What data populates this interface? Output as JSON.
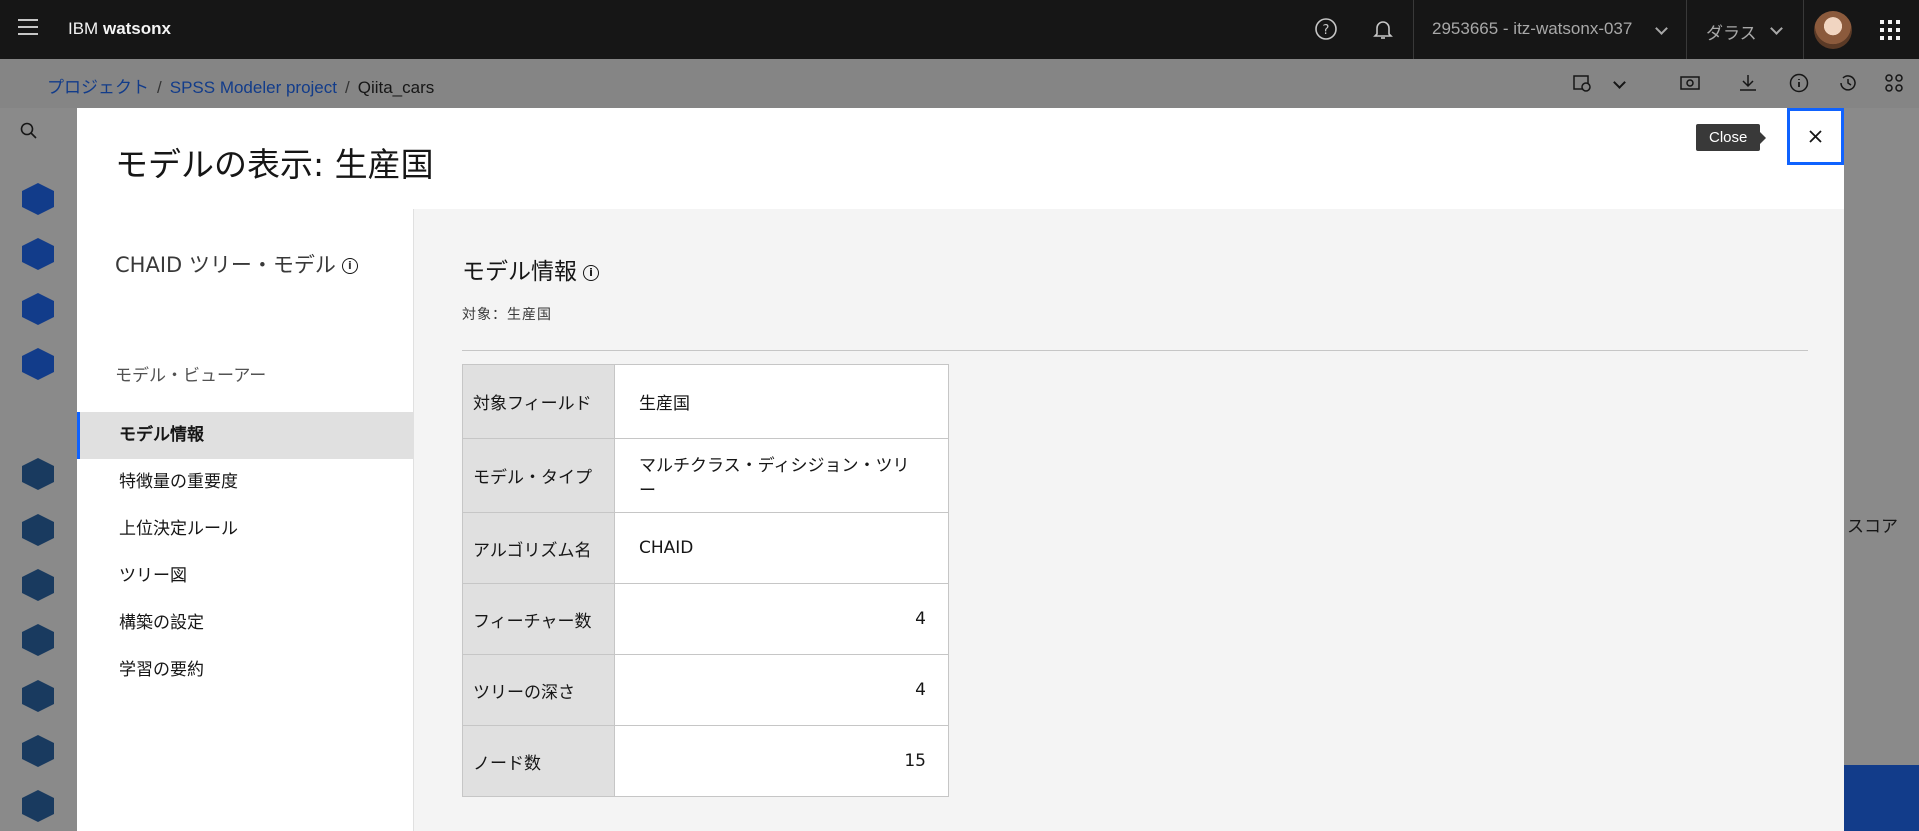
{
  "header": {
    "brand_prefix": "IBM",
    "brand_name": "watsonx",
    "account": "2953665 - itz-watsonx-037",
    "region": "ダラス"
  },
  "breadcrumb": {
    "items": [
      "プロジェクト",
      "SPSS Modeler project"
    ],
    "current": "Qiita_cars"
  },
  "background": {
    "right_text": "スコア"
  },
  "modal": {
    "title": "モデルの表示: 生産国",
    "close_tooltip": "Close",
    "model_name": "CHAID ツリー・モデル",
    "viewer_label": "モデル・ビューアー",
    "nav": [
      {
        "label": "モデル情報",
        "active": true
      },
      {
        "label": "特徴量の重要度",
        "active": false
      },
      {
        "label": "上位決定ルール",
        "active": false
      },
      {
        "label": "ツリー図",
        "active": false
      },
      {
        "label": "構築の設定",
        "active": false
      },
      {
        "label": "学習の要約",
        "active": false
      }
    ],
    "section_title": "モデル情報",
    "target_label": "対象：生産国",
    "table": [
      {
        "key": "対象フィールド",
        "value": "生産国",
        "numeric": false
      },
      {
        "key": "モデル・タイプ",
        "value": "マルチクラス・ディシジョン・ツリー",
        "numeric": false
      },
      {
        "key": "アルゴリズム名",
        "value": "CHAID",
        "numeric": false
      },
      {
        "key": "フィーチャー数",
        "value": "4",
        "numeric": true
      },
      {
        "key": "ツリーの深さ",
        "value": "4",
        "numeric": true
      },
      {
        "key": "ノード数",
        "value": "15",
        "numeric": true
      }
    ]
  },
  "colors": {
    "accent": "#0f62fe",
    "header_bg": "#161616"
  }
}
